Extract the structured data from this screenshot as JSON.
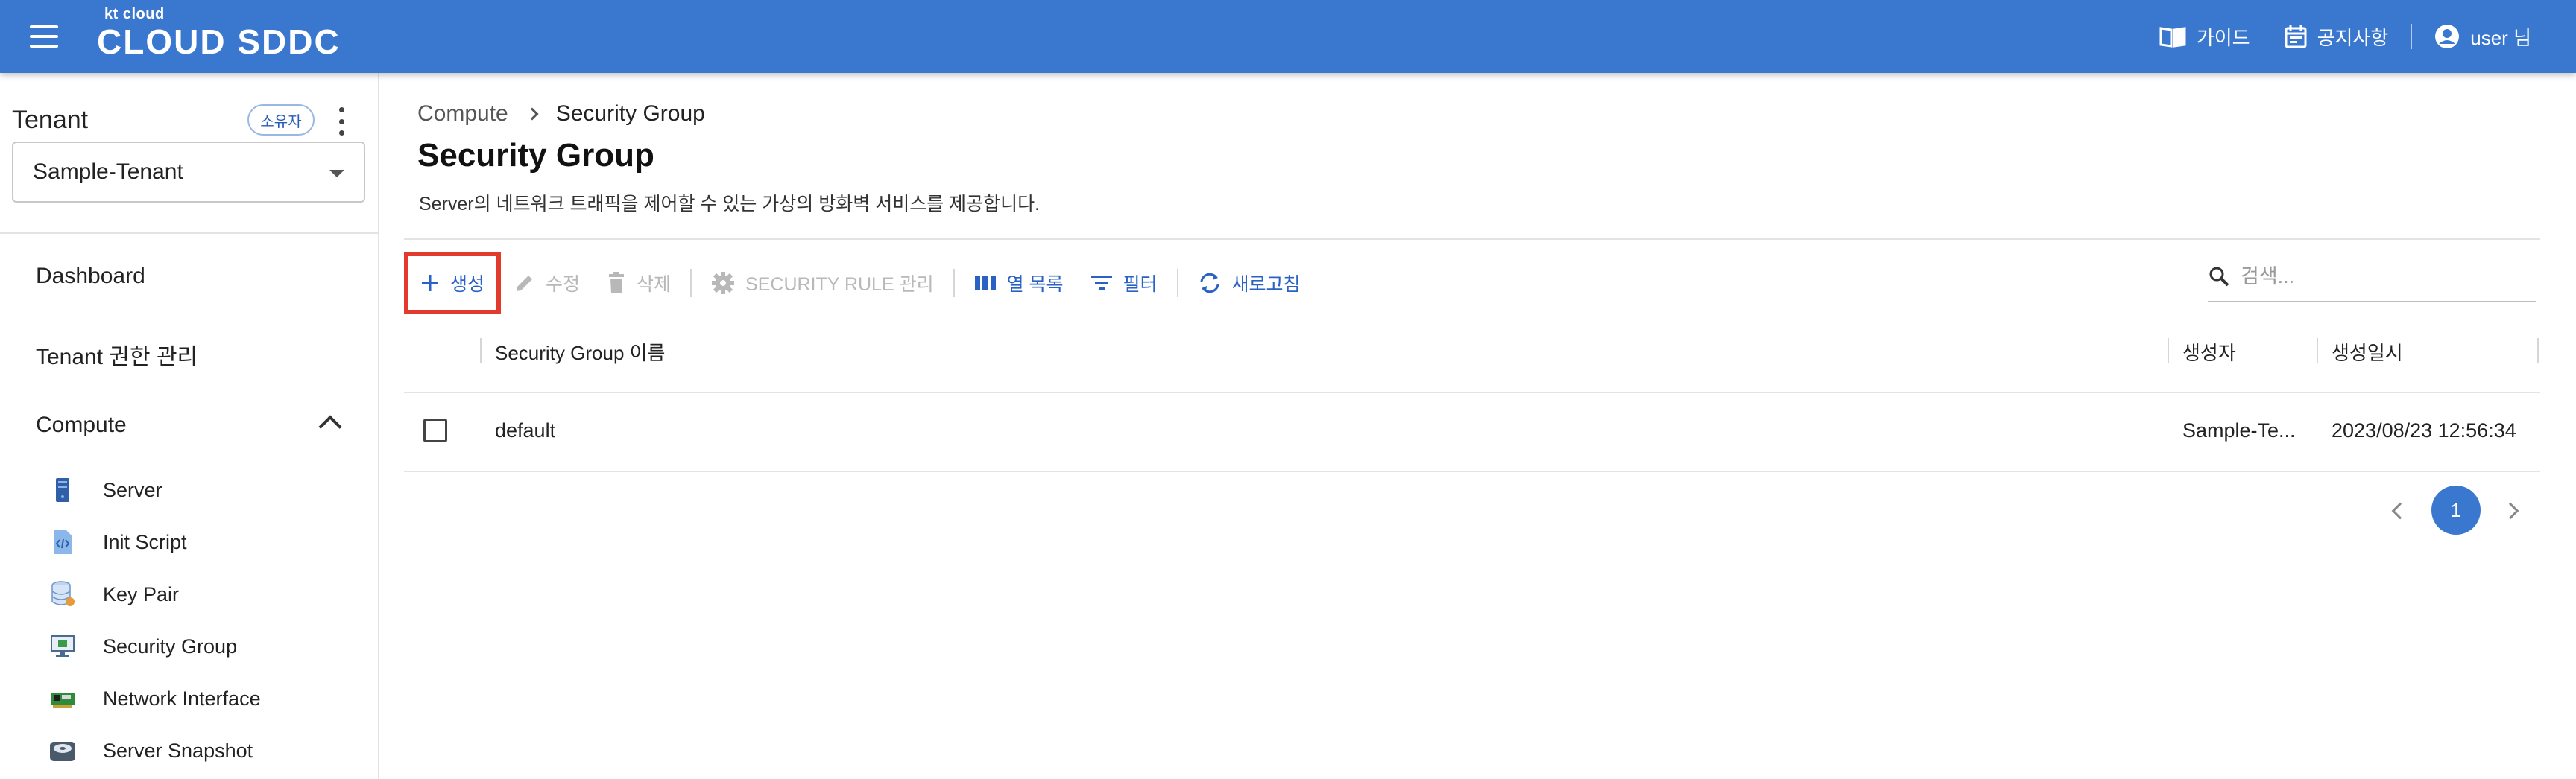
{
  "header": {
    "logo_small": "kt cloud",
    "logo_big": "CLOUD SDDC",
    "guide_label": "가이드",
    "notice_label": "공지사항",
    "user_label": "user 님"
  },
  "sidebar": {
    "tenant_title": "Tenant",
    "owner_badge": "소유자",
    "tenant_selected": "Sample-Tenant",
    "nav": [
      {
        "label": "Dashboard"
      },
      {
        "label": "Tenant 권한 관리"
      },
      {
        "label": "Compute"
      }
    ],
    "compute_items": [
      {
        "label": "Server",
        "icon": "server-icon"
      },
      {
        "label": "Init Script",
        "icon": "script-icon"
      },
      {
        "label": "Key Pair",
        "icon": "database-icon"
      },
      {
        "label": "Security Group",
        "icon": "monitor-icon"
      },
      {
        "label": "Network Interface",
        "icon": "network-card-icon"
      },
      {
        "label": "Server Snapshot",
        "icon": "snapshot-icon"
      }
    ]
  },
  "main": {
    "breadcrumb": [
      "Compute",
      "Security Group"
    ],
    "title": "Security Group",
    "description": "Server의 네트워크 트래픽을 제어할 수 있는 가상의 방화벽 서비스를 제공합니다.",
    "toolbar": {
      "create": "생성",
      "edit": "수정",
      "delete": "삭제",
      "rule_manage": "SECURITY RULE 관리",
      "columns": "열 목록",
      "filter": "필터",
      "refresh": "새로고침"
    },
    "search_placeholder": "검색...",
    "table": {
      "columns": [
        "Security Group 이름",
        "생성자",
        "생성일시"
      ],
      "rows": [
        {
          "name": "default",
          "creator": "Sample-Te...",
          "created_at": "2023/08/23 12:56:34"
        }
      ]
    },
    "pagination": {
      "current_page": "1"
    }
  },
  "colors": {
    "header_bg": "#3a78d0",
    "accent": "#2a62c4",
    "highlight_border": "#e23b2e"
  }
}
